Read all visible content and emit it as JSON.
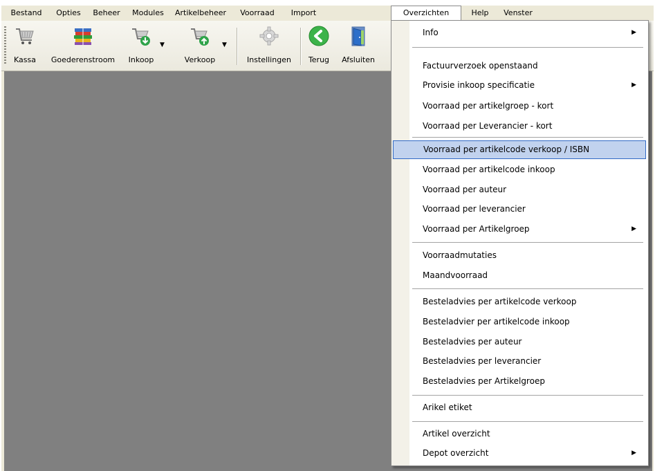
{
  "menubar": {
    "items": [
      "Bestand",
      "Opties",
      "Beheer",
      "Modules",
      "Artikelbeheer",
      "Voorraad",
      "Import",
      "Overzichten",
      "Help",
      "Venster"
    ]
  },
  "toolbar": {
    "buttons": [
      {
        "label": "Kassa",
        "icon": "shopping-cart-icon"
      },
      {
        "label": "Goederenstroom",
        "icon": "stack-of-books-icon"
      },
      {
        "label": "Inkoop",
        "icon": "cart-down-arrow-icon"
      },
      {
        "label": "Verkoop",
        "icon": "cart-up-arrow-icon"
      },
      {
        "label": "Instellingen",
        "icon": "gear-icon"
      },
      {
        "label": "Terug",
        "icon": "back-arrow-icon"
      },
      {
        "label": "Afsluiten",
        "icon": "exit-door-icon"
      }
    ]
  },
  "menu": {
    "title": "Overzichten",
    "items": [
      {
        "label": "Info",
        "submenu": true
      },
      {
        "label": "Factuurverzoek openstaand",
        "submenu": false
      },
      {
        "label": "Provisie inkoop specificatie",
        "submenu": true
      },
      {
        "label": "Voorraad per artikelgroep - kort",
        "submenu": false
      },
      {
        "label": "Voorraad per Leverancier - kort",
        "submenu": false
      },
      {
        "label": "Voorraad per artikelcode verkoop / ISBN",
        "submenu": false,
        "highlighted": true
      },
      {
        "label": "Voorraad per artikelcode inkoop",
        "submenu": false
      },
      {
        "label": "Voorraad per auteur",
        "submenu": false
      },
      {
        "label": "Voorraad per leverancier",
        "submenu": false
      },
      {
        "label": "Voorraad per Artikelgroep",
        "submenu": true
      },
      {
        "label": "Voorraadmutaties",
        "submenu": false
      },
      {
        "label": "Maandvoorraad",
        "submenu": false
      },
      {
        "label": "Besteladvies per artikelcode verkoop",
        "submenu": false
      },
      {
        "label": "Besteladvier per artikelcode inkoop",
        "submenu": false
      },
      {
        "label": "Besteladvies per auteur",
        "submenu": false
      },
      {
        "label": "Besteladvies per leverancier",
        "submenu": false
      },
      {
        "label": "Besteladvies per Artikelgroep",
        "submenu": false
      },
      {
        "label": "Arikel etiket",
        "submenu": false
      },
      {
        "label": "Artikel overzicht",
        "submenu": false
      },
      {
        "label": "Depot overzicht",
        "submenu": true
      }
    ]
  },
  "colors": {
    "workspace": "#808080",
    "chrome": "#ece9d8",
    "highlight": "#c1d2ee",
    "highlight_border": "#316ac5"
  }
}
